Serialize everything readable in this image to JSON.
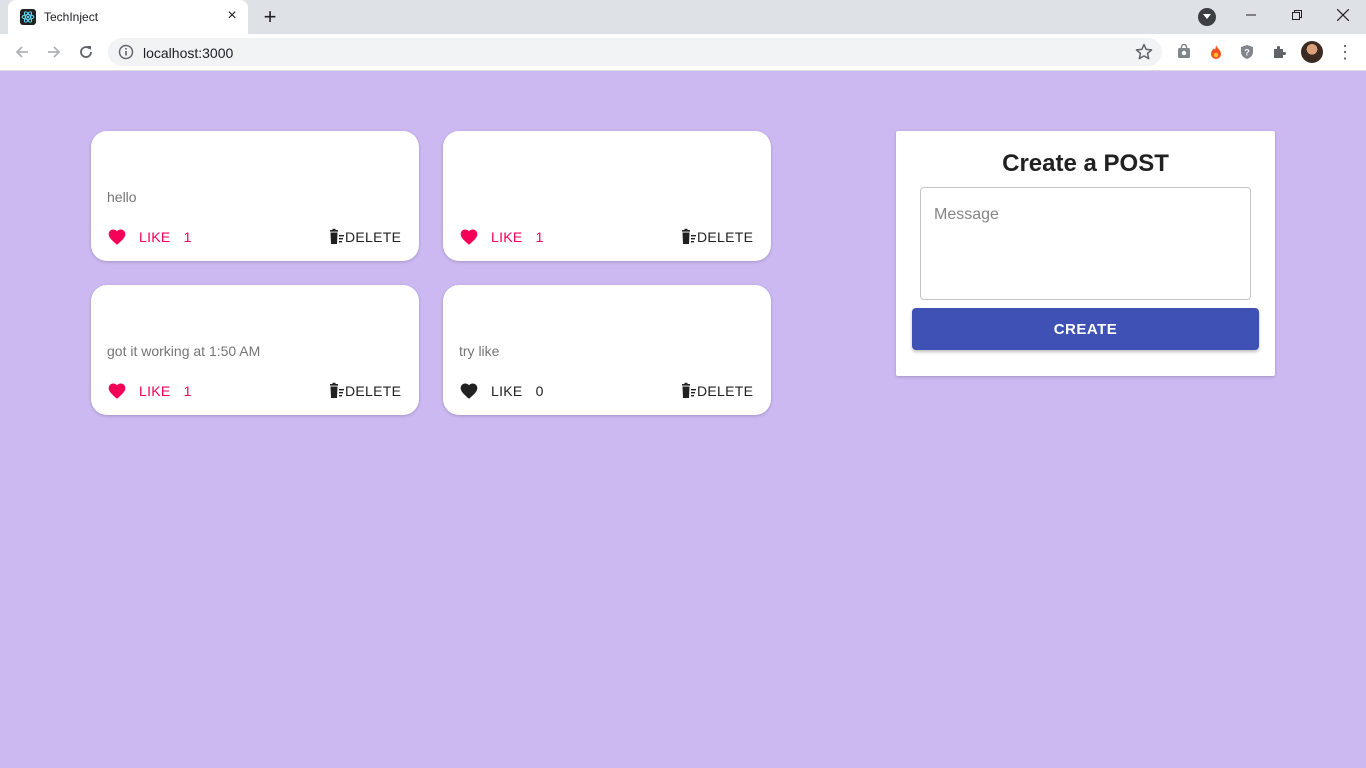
{
  "browser": {
    "tab_title": "TechInject",
    "url": "localhost:3000"
  },
  "posts": [
    {
      "message": "hello",
      "like_label": "LIKE",
      "likes": "1",
      "liked": true,
      "delete_label": "DELETE"
    },
    {
      "message": "",
      "like_label": "LIKE",
      "likes": "1",
      "liked": true,
      "delete_label": "DELETE"
    },
    {
      "message": "got it working at 1:50 AM",
      "like_label": "LIKE",
      "likes": "1",
      "liked": true,
      "delete_label": "DELETE"
    },
    {
      "message": "try like",
      "like_label": "LIKE",
      "likes": "0",
      "liked": false,
      "delete_label": "DELETE"
    }
  ],
  "create_form": {
    "title": "Create a POST",
    "message_placeholder": "Message",
    "message_value": "",
    "submit_label": "CREATE"
  },
  "colors": {
    "page_background": "#ccb9f2",
    "liked": "#f50057",
    "primary_button": "#3f51b5"
  },
  "icons": {
    "favicon": "react-logo-icon",
    "like": "heart-icon",
    "delete": "trash-icon"
  }
}
